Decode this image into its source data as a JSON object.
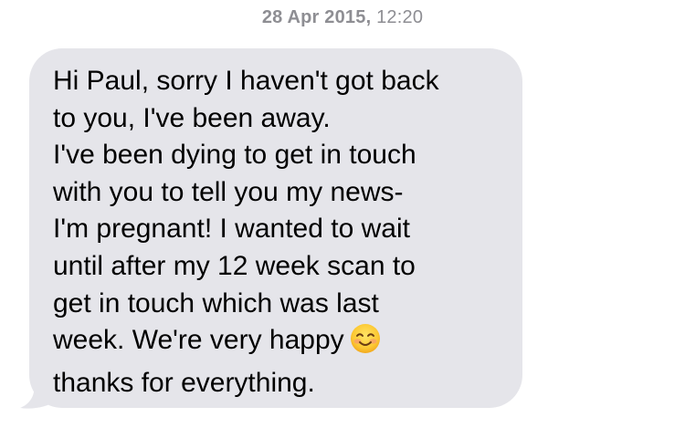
{
  "header": {
    "date": "28 Apr 2015,",
    "time": "12:20"
  },
  "message": {
    "lines": [
      "Hi Paul, sorry I haven't got back",
      "to you, I've been away.",
      "I've been dying to get in touch",
      "with you to tell you my news-",
      "I'm pregnant! I wanted to wait",
      "until after my 12 week scan to",
      "get in touch which was last",
      "week. We're very happy",
      "thanks for everything."
    ],
    "emoji": "smiling-face-emoji"
  },
  "colors": {
    "bubble": "#e5e5ea",
    "timestamp": "#8e8e93",
    "text": "#000000"
  }
}
